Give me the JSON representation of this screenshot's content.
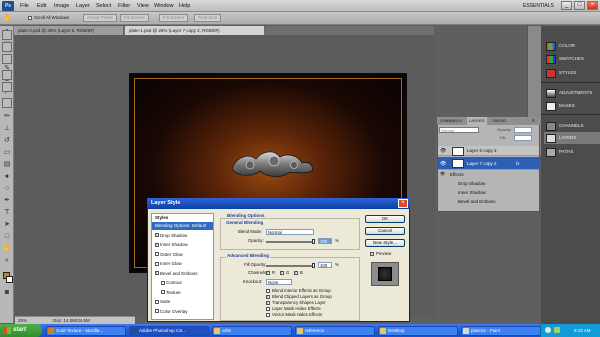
{
  "app": {
    "logo": "Ps",
    "menu": [
      "File",
      "Edit",
      "Image",
      "Layer",
      "Select",
      "Filter",
      "View",
      "Window",
      "Help"
    ],
    "workspace": "ESSENTIALS",
    "window_buttons": [
      "_",
      "□",
      "×"
    ]
  },
  "options_bar": {
    "scroll_all_windows": "Scroll All Windows",
    "buttons": [
      "Actual Pixels",
      "Fit Screen",
      "Fill Screen",
      "Print Size"
    ]
  },
  "doc_tabs": [
    "plate-2.psd @ 25% (Layer 5, RGB/8#)",
    "plate-1.psd @ 25% (Layer 7 copy 2, RGB/8#)"
  ],
  "status": {
    "zoom": "25%",
    "doc": "Doc: 14.0M/34.5M"
  },
  "dock": {
    "items": [
      {
        "label": "COLOR",
        "icon": "color-icon"
      },
      {
        "label": "SWATCHES",
        "icon": "swatches-icon"
      },
      {
        "label": "STYLES",
        "icon": "styles-icon"
      },
      {
        "label": "ADJUSTMENTS",
        "icon": "adjustments-icon"
      },
      {
        "label": "MASKS",
        "icon": "masks-icon"
      },
      {
        "label": "CHANNELS",
        "icon": "channels-icon"
      },
      {
        "label": "LAYERS",
        "icon": "layers-icon"
      },
      {
        "label": "PATHS",
        "icon": "paths-icon"
      }
    ]
  },
  "layers_panel": {
    "tabs": [
      "CHANNELS",
      "LAYERS",
      "PATHS"
    ],
    "blend_mode": "Normal",
    "opacity_label": "Opacity:",
    "fill_label": "Fill:",
    "layers": [
      {
        "name": "Layer 6 copy 2"
      },
      {
        "name": "Layer 7 copy 2",
        "fx": "fx"
      }
    ],
    "effects_label": "Effects",
    "effects": [
      "Drop Shadow",
      "Inner Shadow",
      "Bevel and Emboss"
    ]
  },
  "dialog": {
    "title": "Layer Style",
    "close": "×",
    "styles_header": "Styles",
    "styles": [
      {
        "label": "Blending Options: Default",
        "checkbox": false,
        "selected": true
      },
      {
        "label": "Drop Shadow",
        "checkbox": true,
        "checked": true
      },
      {
        "label": "Inner Shadow",
        "checkbox": true,
        "checked": true
      },
      {
        "label": "Outer Glow",
        "checkbox": true,
        "checked": false
      },
      {
        "label": "Inner Glow",
        "checkbox": true,
        "checked": false
      },
      {
        "label": "Bevel and Emboss",
        "checkbox": true,
        "checked": true
      },
      {
        "label": "Contour",
        "checkbox": true,
        "checked": false,
        "indent": true
      },
      {
        "label": "Texture",
        "checkbox": true,
        "checked": false,
        "indent": true
      },
      {
        "label": "Satin",
        "checkbox": true,
        "checked": false
      },
      {
        "label": "Color Overlay",
        "checkbox": true,
        "checked": false
      }
    ],
    "blending_options": "Blending Options",
    "general_blending": "General Blending",
    "blend_mode_label": "Blend Mode:",
    "blend_mode_value": "Normal",
    "opacity_label": "Opacity:",
    "opacity_value": "100",
    "opacity_fraction": 1.0,
    "percent": "%",
    "advanced_blending": "Advanced Blending",
    "fill_opacity_label": "Fill Opacity:",
    "fill_opacity_value": "100",
    "fill_opacity_fraction": 1.0,
    "channels_label": "Channels:",
    "channels": [
      {
        "label": "R",
        "checked": true
      },
      {
        "label": "G",
        "checked": true
      },
      {
        "label": "B",
        "checked": true
      }
    ],
    "knockout_label": "Knockout:",
    "knockout_value": "None",
    "options": [
      {
        "label": "Blend Interior Effects as Group",
        "checked": false
      },
      {
        "label": "Blend Clipped Layers as Group",
        "checked": true
      },
      {
        "label": "Transparency Shapes Layer",
        "checked": true
      },
      {
        "label": "Layer Mask Hides Effects",
        "checked": false
      },
      {
        "label": "Vector Mask Hides Effects",
        "checked": false
      }
    ],
    "ok": "OK",
    "cancel": "Cancel",
    "new_style": "New Style...",
    "preview": "Preview",
    "preview_checked": true
  },
  "taskbar": {
    "start": "start",
    "tasks": [
      {
        "label": "Gold Texture - Mozilla...",
        "icon": "firefox-icon"
      },
      {
        "label": "Adobe Photoshop CS...",
        "icon": "photoshop-icon",
        "active": true
      },
      {
        "label": "orbit",
        "icon": "folder-icon"
      },
      {
        "label": "reference",
        "icon": "folder-icon"
      },
      {
        "label": "Desktop",
        "icon": "folder-icon"
      },
      {
        "label": "plate12 - Paint",
        "icon": "paint-icon"
      }
    ],
    "clock": "6:19 AM"
  }
}
